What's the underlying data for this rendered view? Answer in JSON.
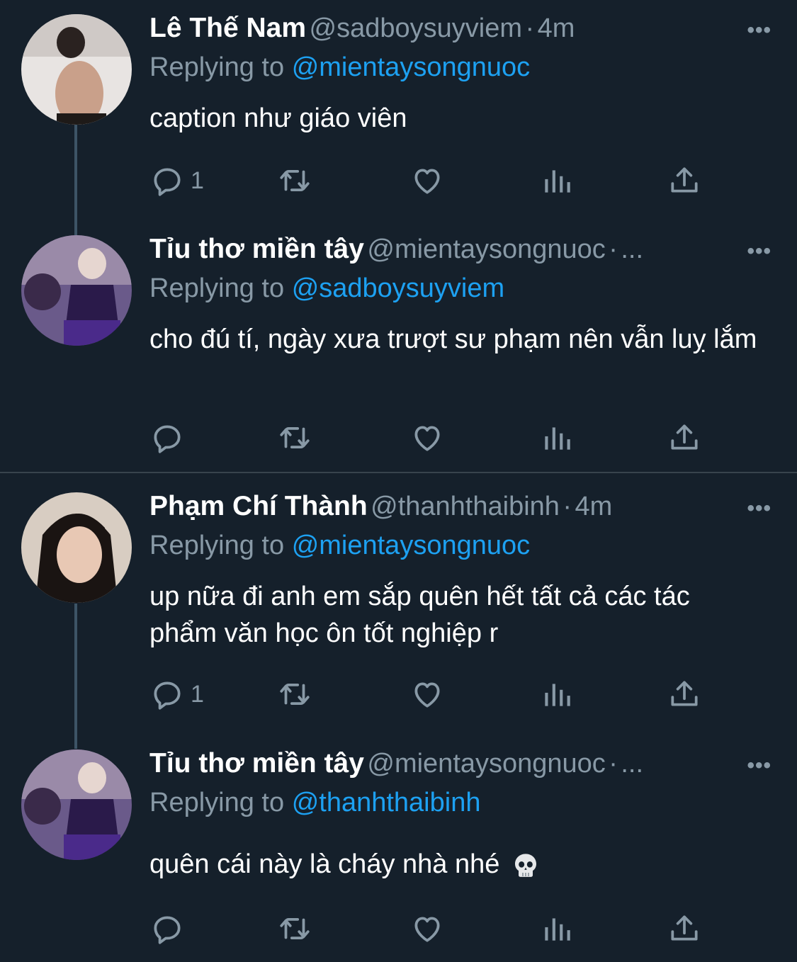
{
  "tweets": [
    {
      "name": "Lê Thế Nam",
      "handle": "@sadboysuyviem",
      "separator": "·",
      "time": "4m",
      "replying_prefix": "Replying to",
      "replying_to": "@mientaysongnuoc",
      "text": "caption như giáo viên",
      "reply_count": "1",
      "more": "•••"
    },
    {
      "name": "Tỉu thơ miền tây",
      "handle": "@mientaysongnuoc",
      "separator": "·",
      "time": "...",
      "replying_prefix": "Replying to",
      "replying_to": "@sadboysuyviem",
      "text": "cho đú tí, ngày xưa trượt sư phạm nên vẫn luỵ lắm",
      "reply_count": "",
      "more": "•••"
    },
    {
      "name": "Phạm Chí Thành",
      "handle": "@thanhthaibinh",
      "separator": "·",
      "time": "4m",
      "replying_prefix": "Replying to",
      "replying_to": "@mientaysongnuoc",
      "text": "up nữa đi anh em sắp quên hết tất cả các tác phẩm văn học ôn tốt nghiệp r",
      "reply_count": "1",
      "more": "•••"
    },
    {
      "name": "Tỉu thơ miền tây",
      "handle": "@mientaysongnuoc",
      "separator": "·",
      "time": "...",
      "replying_prefix": "Replying to",
      "replying_to": "@thanhthaibinh",
      "text": "quên cái này là cháy nhà nhé",
      "reply_count": "",
      "more": "•••"
    }
  ],
  "icons": {
    "reply": "speech-bubble-icon",
    "retweet": "retweet-icon",
    "like": "heart-icon",
    "stats": "bar-chart-icon",
    "share": "share-upload-icon",
    "emoji": "skull-emoji"
  },
  "colors": {
    "background": "#15202b",
    "muted": "#8899a6",
    "link": "#1da1f2",
    "divider": "#38444d"
  }
}
